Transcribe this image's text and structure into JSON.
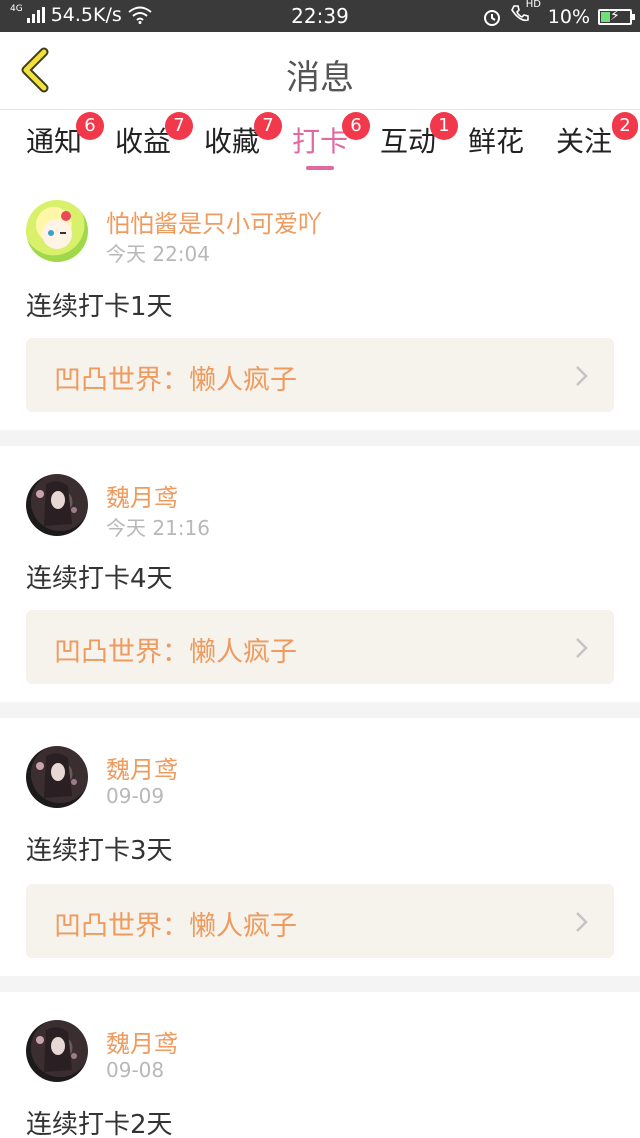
{
  "status_bar": {
    "network": "4G",
    "speed": "54.5K/s",
    "time": "22:39",
    "hd": "HD",
    "battery": "10%"
  },
  "header": {
    "title": "消息",
    "back_icon": "chevron-left-icon"
  },
  "tabs": [
    {
      "label": "通知",
      "badge": "6"
    },
    {
      "label": "收益",
      "badge": "7"
    },
    {
      "label": "收藏",
      "badge": "7"
    },
    {
      "label": "打卡",
      "badge": "6"
    },
    {
      "label": "互动",
      "badge": "1"
    },
    {
      "label": "鲜花",
      "badge": ""
    },
    {
      "label": "关注",
      "badge": "2"
    }
  ],
  "active_tab": "打卡",
  "messages": [
    {
      "user": "怕怕酱是只小可爱吖",
      "time": "今天 22:04",
      "text": "连续打卡1天",
      "link": "凹凸世界：懒人疯子"
    },
    {
      "user": "魏月鸢",
      "time": "今天 21:16",
      "text": "连续打卡4天",
      "link": "凹凸世界：懒人疯子"
    },
    {
      "user": "魏月鸢",
      "time": "09-09",
      "text": "连续打卡3天",
      "link": "凹凸世界：懒人疯子"
    },
    {
      "user": "魏月鸢",
      "time": "09-08",
      "text": "连续打卡2天",
      "link": ""
    }
  ],
  "colors": {
    "accent": "#e06aa0",
    "username": "#ef9a5e",
    "badge": "#f2394c",
    "link_bg": "#f5f3ec"
  }
}
